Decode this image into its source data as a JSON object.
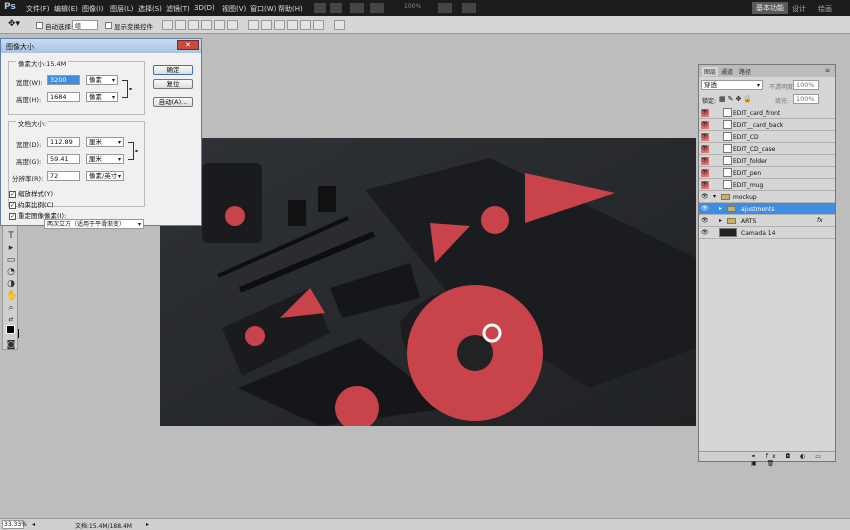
{
  "menubar": {
    "logo": "Ps",
    "items": [
      "文件(F)",
      "编辑(E)",
      "图像(I)",
      "图层(L)",
      "选择(S)",
      "滤镜(T)",
      "3D(D)",
      "视图(V)",
      "窗口(W)",
      "帮助(H)"
    ],
    "zoom": "100%",
    "workspaces": [
      "基本功能",
      "设计",
      "绘画"
    ]
  },
  "options": {
    "auto_select": "自动选择:",
    "auto_select_value": "组",
    "show_transform": "显示变换控件"
  },
  "dialog": {
    "title": "图像大小",
    "close_icon": "close-icon",
    "pixel_dimensions": "像素大小:15.4M",
    "width_label": "宽度(W):",
    "width_value": "3200",
    "width_unit": "像素",
    "height_label": "高度(H):",
    "height_value": "1684",
    "height_unit": "像素",
    "doc_size": "文档大小:",
    "doc_width_label": "宽度(D):",
    "doc_width_value": "112.89",
    "doc_width_unit": "厘米",
    "doc_height_label": "高度(G):",
    "doc_height_value": "59.41",
    "doc_height_unit": "厘米",
    "resolution_label": "分辨率(R):",
    "resolution_value": "72",
    "resolution_unit": "像素/英寸",
    "scale_styles": "缩放样式(Y)",
    "constrain": "约束比例(C)",
    "resample": "重定图像像素(I):",
    "resample_method": "两次立方（适用于平滑渐变）",
    "ok": "确定",
    "reset": "复位",
    "auto": "自动(A)..."
  },
  "layers": {
    "tabs": [
      "图层",
      "通道",
      "路径"
    ],
    "blend_mode": "穿透",
    "opacity_label": "不透明度:",
    "opacity": "100%",
    "lock_label": "锁定:",
    "fill_label": "填充:",
    "fill": "100%",
    "rows": [
      {
        "name": "EDIT_card_front",
        "smart": true
      },
      {
        "name": "EDIT__card_back",
        "smart": true
      },
      {
        "name": "EDIT_CD",
        "smart": true
      },
      {
        "name": "EDIT_CD_case",
        "smart": true
      },
      {
        "name": "EDIT_folder",
        "smart": true
      },
      {
        "name": "EDIT_pen",
        "smart": true
      },
      {
        "name": "EDIT_mug",
        "smart": true
      },
      {
        "name": "mockup",
        "group": true
      },
      {
        "name": "ajustments",
        "group": true,
        "selected": true
      },
      {
        "name": "ARTS",
        "group": true,
        "fx": "fx"
      },
      {
        "name": "Camada 14"
      }
    ]
  },
  "status": {
    "zoom": "33.33%",
    "doc": "文档:15.4M/188.4M"
  },
  "colors": {
    "accent_red": "#c9434a",
    "selected_row": "#3d8ee0",
    "canvas_bg": "#2a2c30"
  }
}
